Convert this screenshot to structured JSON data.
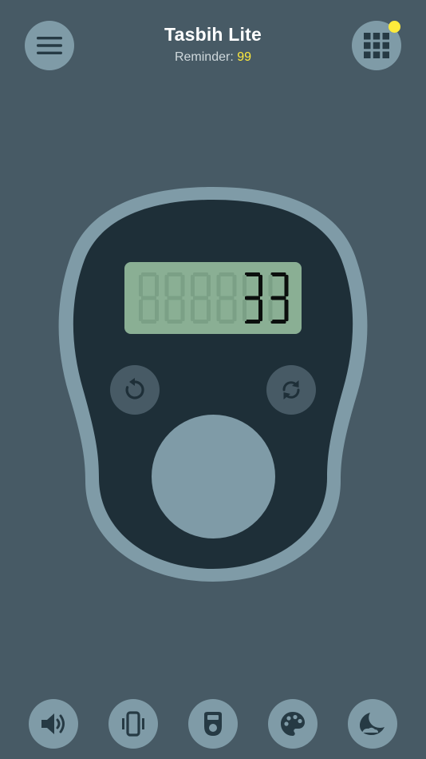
{
  "header": {
    "title": "Tasbih Lite",
    "reminder_label": "Reminder: ",
    "reminder_value": "99"
  },
  "counter": {
    "value": "33",
    "total_digits": 6
  },
  "colors": {
    "background": "#475a65",
    "device_outline": "#7f9ba7",
    "device_body": "#1e2f38",
    "lcd_background": "#8aaf94",
    "lcd_segment_on": "#0b0f0d",
    "lcd_segment_off": "#7ba086",
    "reminder_accent": "#ffeb3b",
    "button_fill": "#7f9ba7"
  },
  "top_buttons": [
    {
      "name": "menu",
      "icon": "hamburger-menu-icon"
    },
    {
      "name": "apps",
      "icon": "grid-icon",
      "has_notification": true
    }
  ],
  "device_buttons": [
    {
      "name": "reset",
      "icon": "undo-icon"
    },
    {
      "name": "refresh",
      "icon": "sync-icon"
    },
    {
      "name": "count",
      "icon": "none"
    }
  ],
  "bottom_toolbar": [
    {
      "name": "sound",
      "icon": "volume-icon"
    },
    {
      "name": "vibration",
      "icon": "vibrate-icon"
    },
    {
      "name": "counter-style",
      "icon": "tally-counter-icon"
    },
    {
      "name": "theme",
      "icon": "palette-icon"
    },
    {
      "name": "night-mode",
      "icon": "moon-icon"
    }
  ]
}
